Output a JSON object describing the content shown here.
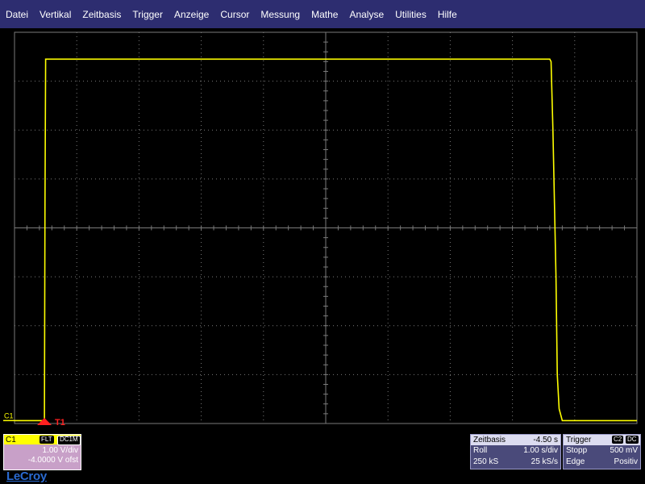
{
  "menu": {
    "items": [
      "Datei",
      "Vertikal",
      "Zeitbasis",
      "Trigger",
      "Anzeige",
      "Cursor",
      "Messung",
      "Mathe",
      "Analyse",
      "Utilities",
      "Hilfe"
    ]
  },
  "display": {
    "channel_marker": "C1",
    "trigger_marker": "T1",
    "trace_color": "#ffff00",
    "grid_color": "#7a7a7a",
    "trigger_marker_color": "#ff2020"
  },
  "chart_data": {
    "type": "line",
    "x_divisions": 10,
    "y_divisions": 8,
    "x_unit_per_div": "1.00 s/div",
    "y_unit_per_div": "1.00 V/div",
    "series": [
      {
        "color": "#ffff00",
        "x_div": [
          0,
          0.48,
          0.49,
          0.5,
          8.6,
          8.62,
          8.65,
          8.7,
          8.72,
          8.75,
          8.8,
          10
        ],
        "y_div": [
          0.06,
          0.06,
          4.5,
          7.45,
          7.45,
          7.4,
          6.0,
          3.0,
          1.0,
          0.3,
          0.06,
          0.06
        ]
      }
    ]
  },
  "channel": {
    "name": "C1",
    "filter": "FLT",
    "coupling": "DC1M",
    "vdiv": "1.00 V/div",
    "offset": "-4.0000 V ofst",
    "color": "#ffff00"
  },
  "timebase": {
    "title": "Zeitbasis",
    "delay": "-4.50 s",
    "mode": "Roll",
    "tdiv": "1.00 s/div",
    "samples": "250 kS",
    "rate": "25 kS/s"
  },
  "trigger": {
    "title": "Trigger",
    "source": "C2",
    "coupling": "DC",
    "mode": "Stopp",
    "level": "500 mV",
    "type": "Edge",
    "slope": "Positiv"
  },
  "brand": {
    "logo": "LeCroy"
  }
}
